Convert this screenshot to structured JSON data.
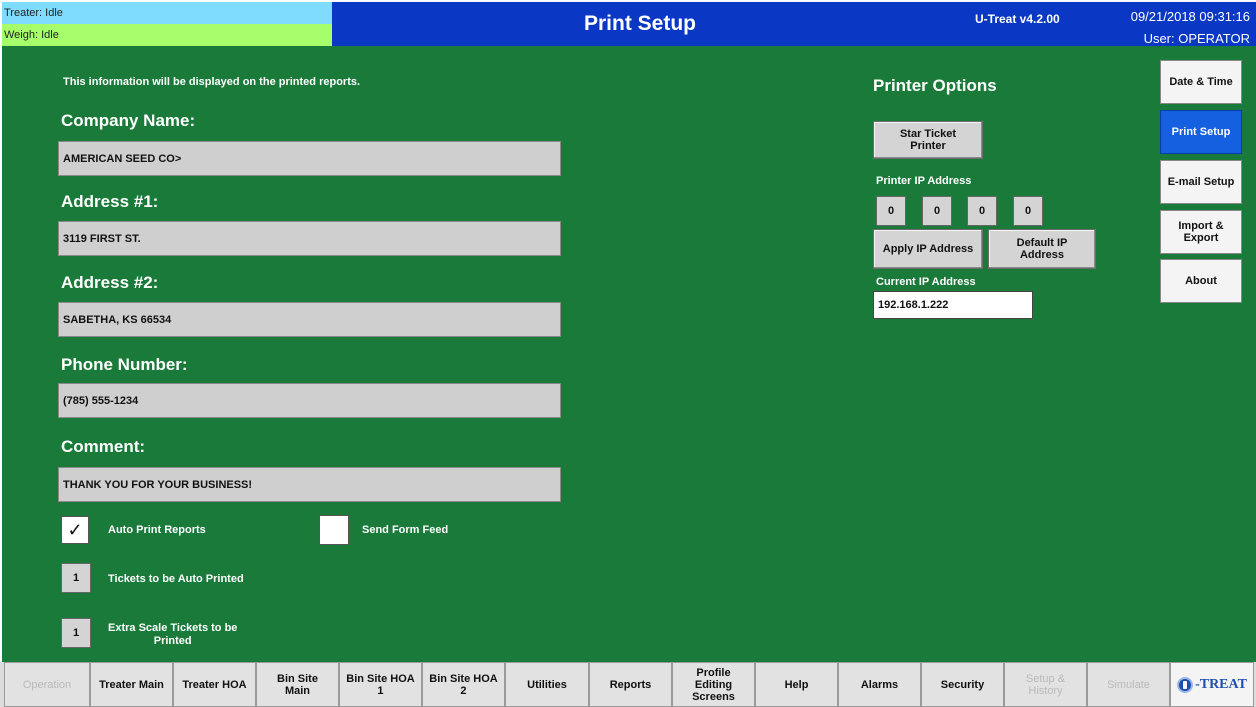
{
  "status": {
    "treater": "Treater: Idle",
    "weigh": "Weigh: Idle",
    "treater_color": "#7fdcff",
    "weigh_color": "#a6ff6a"
  },
  "header": {
    "title": "Print Setup",
    "version": "U-Treat v4.2.00",
    "datetime": "09/21/2018 09:31:16",
    "user": "User: OPERATOR"
  },
  "form": {
    "info": "This information will be displayed on the printed reports.",
    "company_label": "Company Name:",
    "company_value": "AMERICAN SEED CO>",
    "address1_label": "Address #1:",
    "address1_value": "3119 FIRST ST.",
    "address2_label": "Address #2:",
    "address2_value": "SABETHA, KS 66534",
    "phone_label": "Phone Number:",
    "phone_value": "(785) 555-1234",
    "comment_label": "Comment:",
    "comment_value": "THANK YOU FOR YOUR BUSINESS!",
    "auto_print_label": "Auto Print Reports",
    "auto_print_checked": true,
    "auto_print_mark": "✓",
    "form_feed_label": "Send Form Feed",
    "form_feed_checked": false,
    "tickets_count": "1",
    "tickets_label": "Tickets to be Auto Printed",
    "extra_count": "1",
    "extra_label_line1": "Extra Scale Tickets to be",
    "extra_label_line2": "Printed"
  },
  "printer": {
    "title": "Printer Options",
    "printer_button_line1": "Star Ticket",
    "printer_button_line2": "Printer",
    "ip_label": "Printer IP Address",
    "ip_octets": [
      "0",
      "0",
      "0",
      "0"
    ],
    "apply_button": "Apply IP Address",
    "default_button_line1": "Default IP",
    "default_button_line2": "Address",
    "current_ip_label": "Current IP Address",
    "current_ip_value": "192.168.1.222"
  },
  "sidebar": {
    "items": [
      {
        "label": "Date & Time",
        "active": false
      },
      {
        "label": "Print Setup",
        "active": true
      },
      {
        "label": "E-mail Setup",
        "active": false
      },
      {
        "label_line1": "Import &",
        "label_line2": "Export",
        "active": false
      },
      {
        "label": "About",
        "active": false
      }
    ]
  },
  "nav": {
    "items": [
      {
        "label": "Operation",
        "enabled": false
      },
      {
        "label": "Treater Main",
        "enabled": true
      },
      {
        "label": "Treater HOA",
        "enabled": true
      },
      {
        "line1": "Bin Site",
        "line2": "Main",
        "enabled": true
      },
      {
        "line1": "Bin Site HOA",
        "line2": "1",
        "enabled": true
      },
      {
        "line1": "Bin Site HOA",
        "line2": "2",
        "enabled": true
      },
      {
        "label": "Utilities",
        "enabled": true
      },
      {
        "label": "Reports",
        "enabled": true
      },
      {
        "line1": "Profile",
        "line2": "Editing",
        "line3": "Screens",
        "enabled": true
      },
      {
        "label": "Help",
        "enabled": true
      },
      {
        "label": "Alarms",
        "enabled": true
      },
      {
        "label": "Security",
        "enabled": true
      },
      {
        "line1": "Setup &",
        "line2": "History",
        "enabled": false
      },
      {
        "label": "Simulate",
        "enabled": false
      }
    ],
    "logo_text": "-TREAT",
    "logo_icon": "u-treat-logo-icon"
  },
  "colors": {
    "header_blue": "#0a38c4",
    "main_green": "#1a7a3a",
    "active_blue": "#1560e0"
  }
}
